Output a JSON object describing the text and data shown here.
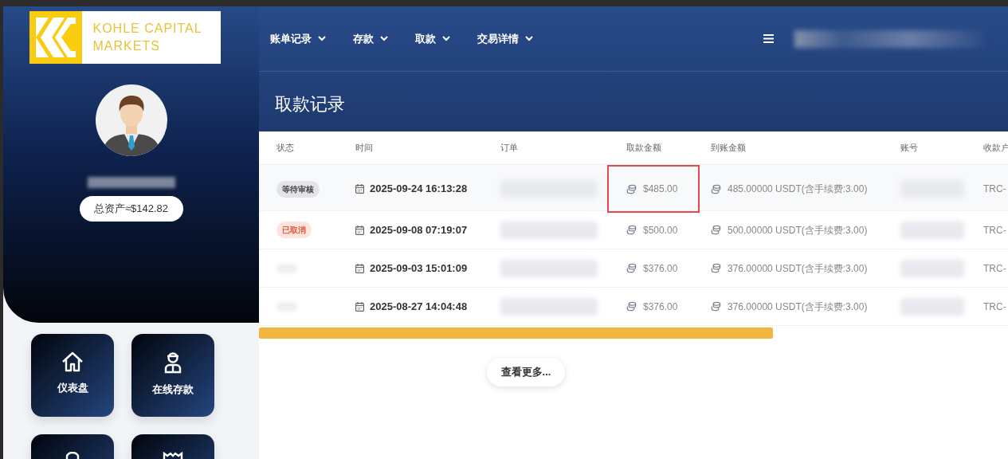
{
  "logo": {
    "line_1": "KOHLE CAPITAL",
    "line_2": "MARKETS"
  },
  "nav": [
    {
      "label": "账单记录"
    },
    {
      "label": "存款"
    },
    {
      "label": "取款"
    },
    {
      "label": "交易详情"
    }
  ],
  "sidebar": {
    "total_assets": "总资产≈$142.82",
    "tiles": [
      {
        "label": "仪表盘",
        "kind": "home"
      },
      {
        "label": "在线存款",
        "kind": "person"
      },
      {
        "kind": "bag"
      },
      {
        "kind": "receipt"
      }
    ]
  },
  "page_title": "取款记录",
  "table": {
    "columns": [
      "状态",
      "时间",
      "订单",
      "取款金额",
      "到账金额",
      "账号",
      "收款户"
    ],
    "rows": [
      {
        "status": {
          "kind": "pending",
          "label": "等待审核"
        },
        "time": "2025-09-24 16:13:28",
        "amount": "$485.00",
        "received": "485.00000 USDT(含手续费:3.00)",
        "network": "TRC-",
        "marked": true
      },
      {
        "status": {
          "kind": "cancelled",
          "label": "已取消"
        },
        "time": "2025-09-08 07:19:07",
        "amount": "$500.00",
        "received": "500.00000 USDT(含手续费:3.00)",
        "network": "TRC-",
        "marked": false
      },
      {
        "status": {
          "kind": "hidden"
        },
        "time": "2025-09-03 15:01:09",
        "amount": "$376.00",
        "received": "376.00000 USDT(含手续费:3.00)",
        "network": "TRC-",
        "marked": false
      },
      {
        "status": {
          "kind": "hidden"
        },
        "time": "2025-08-27 14:04:48",
        "amount": "$376.00",
        "received": "376.00000 USDT(含手续费:3.00)",
        "network": "TRC-",
        "marked": false
      }
    ]
  },
  "more_button": "查看更多..."
}
